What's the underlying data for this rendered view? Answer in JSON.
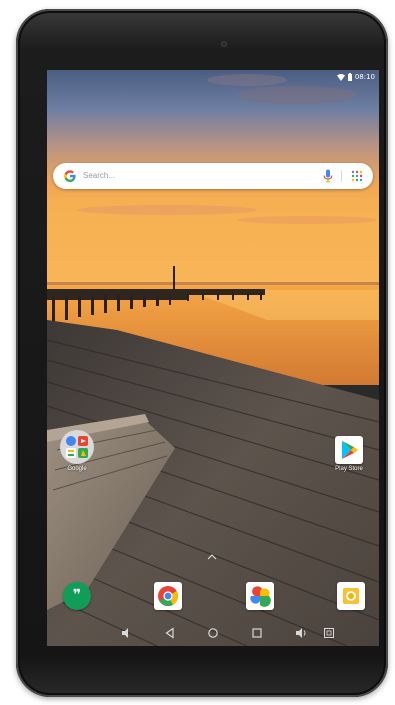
{
  "status_bar": {
    "time": "08:10",
    "icons": [
      "wifi-icon",
      "battery-icon"
    ]
  },
  "search": {
    "placeholder": "Search...",
    "left_icon": "google-g-icon",
    "right_icons": [
      "mic-icon",
      "apps-grid-icon"
    ]
  },
  "home_apps": [
    {
      "label": "Google",
      "icon": "google-folder-icon"
    },
    {
      "label": "Play Store",
      "icon": "play-store-icon"
    }
  ],
  "dock": [
    {
      "icon": "hangouts-icon"
    },
    {
      "icon": "chrome-icon"
    },
    {
      "icon": "photos-icon"
    },
    {
      "icon": "gallery-icon"
    }
  ],
  "navigation": [
    "volume-down-icon",
    "back-icon",
    "home-icon",
    "recents-icon",
    "volume-up-icon",
    "screenshot-icon"
  ],
  "colors": {
    "bezel": "#1a1a1a",
    "sky_top": "#4c5d82",
    "sunset": "#f4a03c",
    "water": "#e79a43",
    "deck": "#5a5148",
    "google_blue": "#4285f4",
    "google_red": "#ea4335",
    "google_yellow": "#fbbc05",
    "google_green": "#34a853",
    "hangouts_green": "#0f9d58"
  }
}
